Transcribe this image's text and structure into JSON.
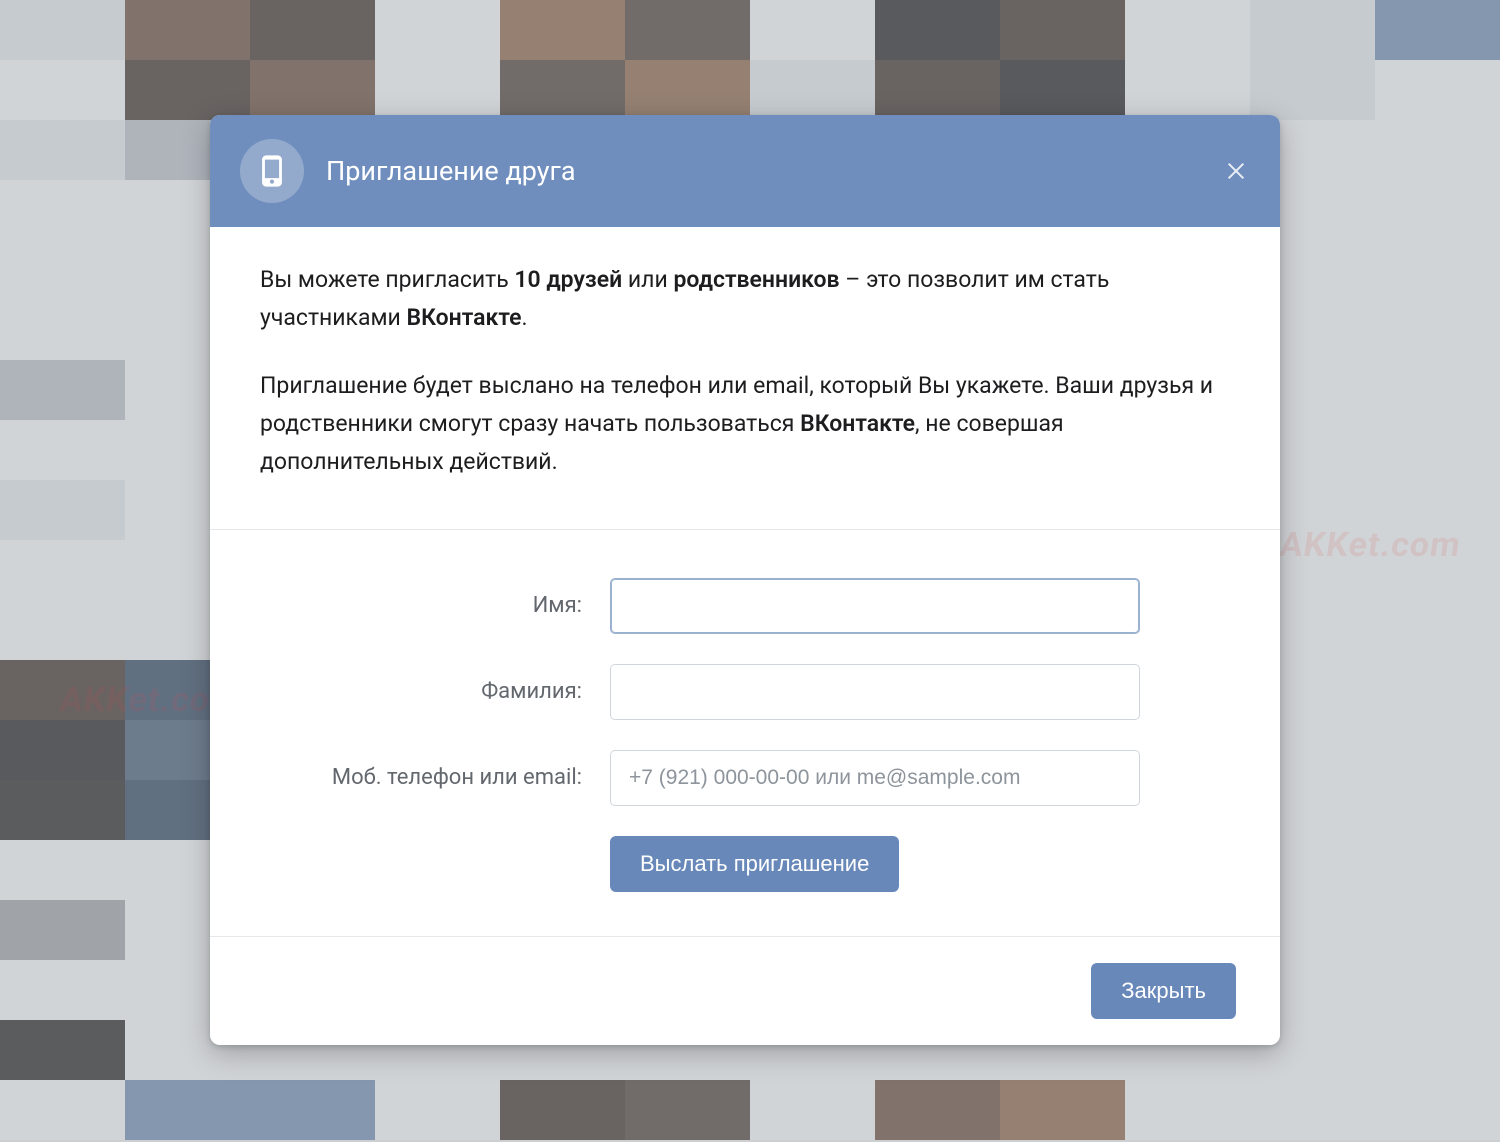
{
  "dialog": {
    "title": "Приглашение друга",
    "intro1_pre": "Вы можете пригласить ",
    "intro1_b1": "10 друзей",
    "intro1_mid": " или ",
    "intro1_b2": "родственников",
    "intro1_post": " – это позволит им стать участниками ",
    "intro1_b3": "ВКонтакте",
    "intro1_end": ".",
    "intro2_pre": "Приглашение будет выслано на телефон или email, который Вы укажете. Ваши друзья и родственники смогут сразу начать пользоваться ",
    "intro2_b": "ВКонтакте",
    "intro2_post": ", не совершая дополнительных действий."
  },
  "form": {
    "name_label": "Имя:",
    "surname_label": "Фамилия:",
    "contact_label": "Моб. телефон или email:",
    "name_value": "",
    "surname_value": "",
    "contact_value": "",
    "contact_placeholder": "+7 (921) 000-00-00 или me@sample.com",
    "submit_label": "Выслать приглашение"
  },
  "footer": {
    "close_label": "Закрыть"
  },
  "watermark": "AKKet.com"
}
